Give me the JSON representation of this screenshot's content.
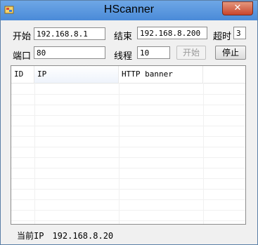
{
  "window": {
    "title": "HScanner"
  },
  "controls": {
    "start_label": "开始",
    "start_value": "192.168.8.1",
    "end_label": "结束",
    "end_value": "192.168.8.200",
    "timeout_label": "超时",
    "timeout_value": "3",
    "port_label": "端口",
    "port_value": "80",
    "threads_label": "线程",
    "threads_value": "10",
    "start_button": "开始",
    "stop_button": "停止"
  },
  "list": {
    "columns": [
      "ID",
      "IP",
      "HTTP banner"
    ],
    "rows": []
  },
  "status": {
    "label": "当前IP",
    "value": "192.168.8.20"
  }
}
